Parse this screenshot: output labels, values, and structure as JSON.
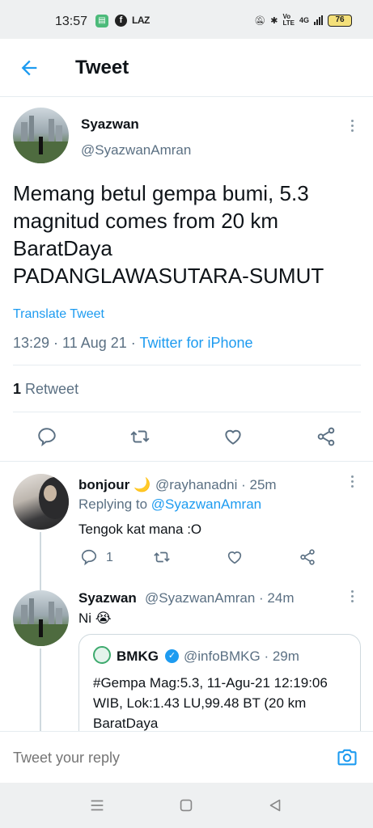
{
  "status_bar": {
    "time": "13:57",
    "notif_text": "LAZ",
    "network": "4G",
    "battery": "76"
  },
  "header": {
    "title": "Tweet"
  },
  "tweet": {
    "name": "Syazwan",
    "handle": "@SyazwanAmran",
    "text": "Memang betul gempa bumi, 5.3 magnitud comes from 20 km BaratDaya PADANGLAWASUTARA-SUMUT",
    "translate_label": "Translate Tweet",
    "time": "13:29",
    "date": "11 Aug 21",
    "source": "Twitter for iPhone",
    "retweet_count": "1",
    "retweet_label": "Retweet"
  },
  "replies": [
    {
      "name": "bonjour 🌙",
      "handle_time": "@rayhanadni · 25m",
      "replying_prefix": "Replying to",
      "replying_to": "@SyazwanAmran",
      "text": "Tengok kat mana :O",
      "reply_count": "1"
    },
    {
      "name": "Syazwan",
      "handle_time": "@SyazwanAmran · 24m",
      "text": "Ni 😭",
      "quote": {
        "name": "BMKG",
        "handle_time": "@infoBMKG · 29m",
        "text": "#Gempa Mag:5.3, 11-Agu-21 12:19:06 WIB, Lok:1.43 LU,99.48 BT (20 km BaratDaya"
      }
    }
  ],
  "reply_box": {
    "placeholder": "Tweet your reply"
  },
  "colors": {
    "accent": "#1d9bf0",
    "secondary_text": "#5b7083"
  }
}
